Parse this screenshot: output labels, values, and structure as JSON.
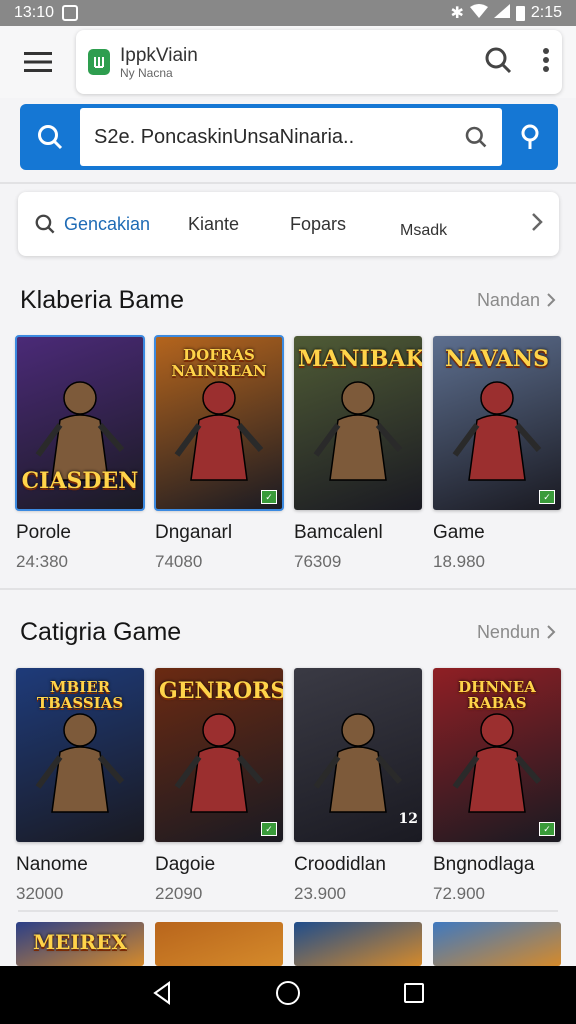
{
  "status_bar": {
    "time_left": "13:10",
    "time_right": "2:15"
  },
  "app_bar": {
    "title": "IppkViain",
    "subtitle": "Ny Nacna"
  },
  "search": {
    "value": "S2e. PoncaskinUnsaNinaria.."
  },
  "chips": [
    {
      "label": "Gencakian",
      "active": true
    },
    {
      "label": "Kiante",
      "active": false
    },
    {
      "label": "Fopars",
      "active": false
    },
    {
      "label": "Msadk",
      "active": false
    }
  ],
  "sections": [
    {
      "title": "Klaberia Bame",
      "more": "Nandan",
      "cards": [
        {
          "name": "Porole",
          "count": "24:380",
          "art_title": "CIASDEN",
          "bg": "#4b2a78",
          "selected": true
        },
        {
          "name": "Dnganarl",
          "count": "74080",
          "art_title": "DOFRAS NAINREAN",
          "bg": "#b5651d",
          "selected": true
        },
        {
          "name": "Bamcalenl",
          "count": "76309",
          "art_title": "MANIBAK",
          "bg": "#4f5b35",
          "selected": false
        },
        {
          "name": "Game",
          "count": "18.980",
          "art_title": "NAVANS",
          "bg": "#5d6f8f",
          "selected": false
        }
      ]
    },
    {
      "title": "Catigria Game",
      "more": "Nendun",
      "cards": [
        {
          "name": "Nanome",
          "count": "32000",
          "art_title": "MBIER TBASSIAS",
          "bg": "#1e3b7a",
          "selected": false
        },
        {
          "name": "Dagoie",
          "count": "22090",
          "art_title": "GENRORS",
          "bg": "#6b2a12",
          "selected": false
        },
        {
          "name": "Croodidlan",
          "count": "23.900",
          "art_title": "12",
          "bg": "#3a3a44",
          "selected": false
        },
        {
          "name": "Bngnodlaga",
          "count": "72.900",
          "art_title": "DHNNEA RABAS",
          "bg": "#8f1f24",
          "selected": false
        }
      ]
    }
  ],
  "third_row": [
    {
      "art_title": "MEIREX",
      "bg": "#2b3f88"
    },
    {
      "art_title": "",
      "bg": "#b8651c"
    },
    {
      "art_title": "",
      "bg": "#1f4d8c"
    },
    {
      "art_title": "",
      "bg": "#3f79c0"
    }
  ],
  "colors": {
    "accent": "#1577d4",
    "selection": "#3c8ae0",
    "logo": "#2e9e4f"
  },
  "icons": [
    "menu-icon",
    "app-logo-icon",
    "search-icon",
    "more-vert-icon",
    "location-icon",
    "chevron-right-icon",
    "back-icon",
    "home-icon",
    "recents-icon"
  ]
}
